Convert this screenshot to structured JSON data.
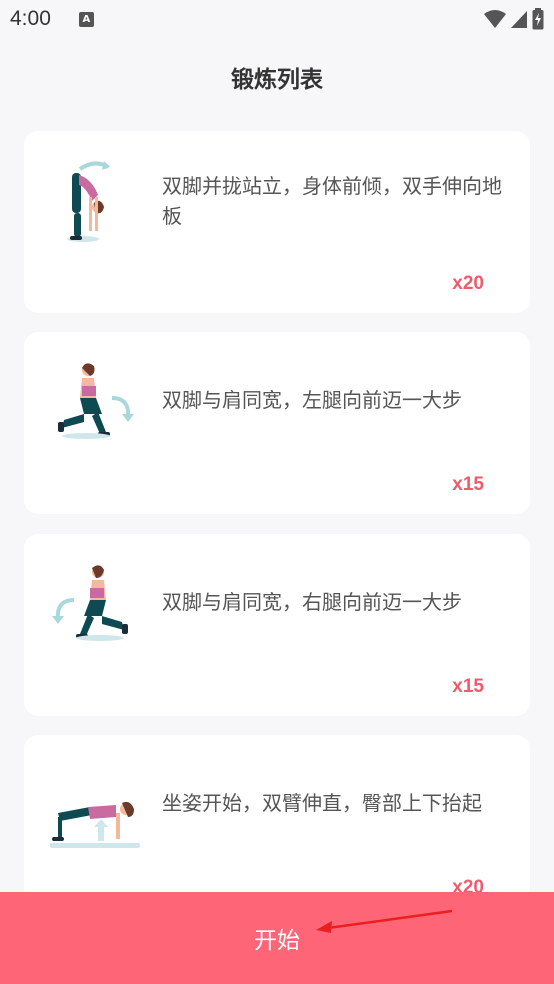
{
  "status_bar": {
    "time": "4:00",
    "notification_icon": "A"
  },
  "header": {
    "title": "锻炼列表"
  },
  "exercises": [
    {
      "description": "双脚并拢站立，身体前倾，双手伸向地板",
      "count": "x20",
      "icon": "forward-bend-icon"
    },
    {
      "description": "双脚与肩同宽，左腿向前迈一大步",
      "count": "x15",
      "icon": "left-lunge-icon"
    },
    {
      "description": "双脚与肩同宽，右腿向前迈一大步",
      "count": "x15",
      "icon": "right-lunge-icon"
    },
    {
      "description": "坐姿开始，双臂伸直，臀部上下抬起",
      "count": "x20",
      "icon": "hip-lift-icon"
    }
  ],
  "start_button": {
    "label": "开始"
  },
  "colors": {
    "accent": "#fe6677",
    "count_text": "#ef5a6d",
    "background": "#f7f7f9",
    "annotation_arrow": "#e82020"
  }
}
